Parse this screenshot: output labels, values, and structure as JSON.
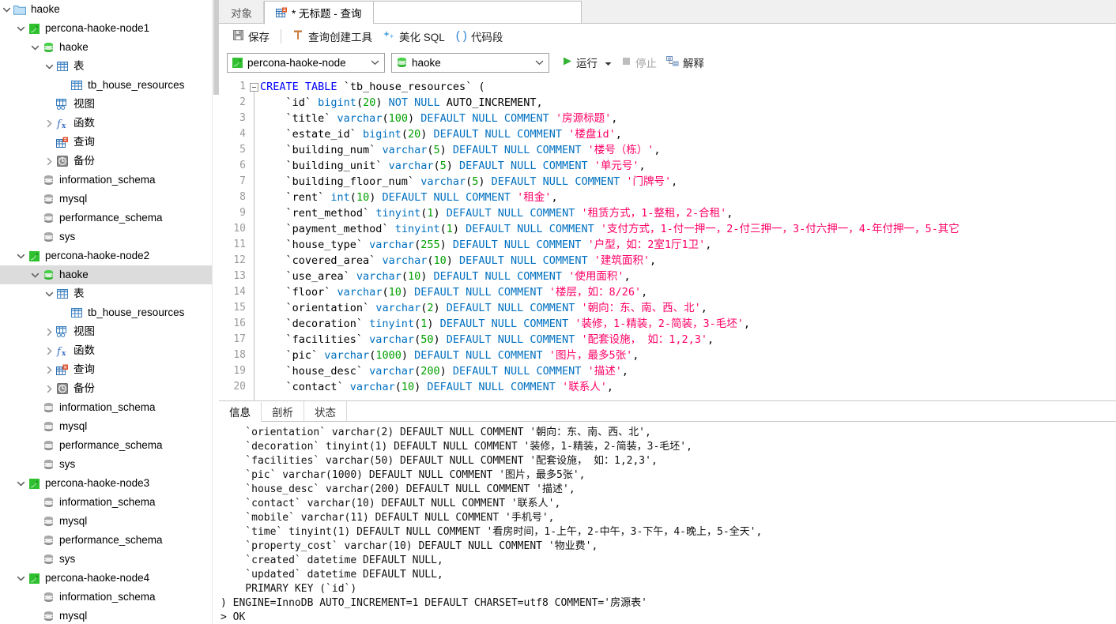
{
  "sidebar": {
    "items": [
      {
        "label": "haoke",
        "depth": 0,
        "icon": "folder-icon",
        "twisty": "down",
        "selected": false
      },
      {
        "label": "percona-haoke-node1",
        "depth": 1,
        "icon": "server-connection-icon",
        "twisty": "down",
        "selected": false
      },
      {
        "label": "haoke",
        "depth": 2,
        "icon": "database-icon",
        "twisty": "down",
        "selected": false
      },
      {
        "label": "表",
        "depth": 3,
        "icon": "table-group-icon",
        "twisty": "down",
        "selected": false
      },
      {
        "label": "tb_house_resources",
        "depth": 4,
        "icon": "table-icon",
        "twisty": "none",
        "selected": false
      },
      {
        "label": "视图",
        "depth": 3,
        "icon": "view-icon",
        "twisty": "none",
        "selected": false
      },
      {
        "label": "函数",
        "depth": 3,
        "icon": "function-icon",
        "twisty": "right",
        "selected": false
      },
      {
        "label": "查询",
        "depth": 3,
        "icon": "query-icon",
        "twisty": "none",
        "selected": false
      },
      {
        "label": "备份",
        "depth": 3,
        "icon": "backup-icon",
        "twisty": "right",
        "selected": false
      },
      {
        "label": "information_schema",
        "depth": 2,
        "icon": "database-gray-icon",
        "twisty": "none",
        "selected": false
      },
      {
        "label": "mysql",
        "depth": 2,
        "icon": "database-gray-icon",
        "twisty": "none",
        "selected": false
      },
      {
        "label": "performance_schema",
        "depth": 2,
        "icon": "database-gray-icon",
        "twisty": "none",
        "selected": false
      },
      {
        "label": "sys",
        "depth": 2,
        "icon": "database-gray-icon",
        "twisty": "none",
        "selected": false
      },
      {
        "label": "percona-haoke-node2",
        "depth": 1,
        "icon": "server-connection-icon",
        "twisty": "down",
        "selected": false
      },
      {
        "label": "haoke",
        "depth": 2,
        "icon": "database-icon",
        "twisty": "down",
        "selected": true
      },
      {
        "label": "表",
        "depth": 3,
        "icon": "table-group-icon",
        "twisty": "down",
        "selected": false
      },
      {
        "label": "tb_house_resources",
        "depth": 4,
        "icon": "table-icon",
        "twisty": "none",
        "selected": false
      },
      {
        "label": "视图",
        "depth": 3,
        "icon": "view-icon",
        "twisty": "right",
        "selected": false
      },
      {
        "label": "函数",
        "depth": 3,
        "icon": "function-icon",
        "twisty": "right",
        "selected": false
      },
      {
        "label": "查询",
        "depth": 3,
        "icon": "query-icon",
        "twisty": "right",
        "selected": false
      },
      {
        "label": "备份",
        "depth": 3,
        "icon": "backup-icon",
        "twisty": "right",
        "selected": false
      },
      {
        "label": "information_schema",
        "depth": 2,
        "icon": "database-gray-icon",
        "twisty": "none",
        "selected": false
      },
      {
        "label": "mysql",
        "depth": 2,
        "icon": "database-gray-icon",
        "twisty": "none",
        "selected": false
      },
      {
        "label": "performance_schema",
        "depth": 2,
        "icon": "database-gray-icon",
        "twisty": "none",
        "selected": false
      },
      {
        "label": "sys",
        "depth": 2,
        "icon": "database-gray-icon",
        "twisty": "none",
        "selected": false
      },
      {
        "label": "percona-haoke-node3",
        "depth": 1,
        "icon": "server-connection-icon",
        "twisty": "down",
        "selected": false
      },
      {
        "label": "information_schema",
        "depth": 2,
        "icon": "database-gray-icon",
        "twisty": "none",
        "selected": false
      },
      {
        "label": "mysql",
        "depth": 2,
        "icon": "database-gray-icon",
        "twisty": "none",
        "selected": false
      },
      {
        "label": "performance_schema",
        "depth": 2,
        "icon": "database-gray-icon",
        "twisty": "none",
        "selected": false
      },
      {
        "label": "sys",
        "depth": 2,
        "icon": "database-gray-icon",
        "twisty": "none",
        "selected": false
      },
      {
        "label": "percona-haoke-node4",
        "depth": 1,
        "icon": "server-connection-icon",
        "twisty": "down",
        "selected": false
      },
      {
        "label": "information_schema",
        "depth": 2,
        "icon": "database-gray-icon",
        "twisty": "none",
        "selected": false
      },
      {
        "label": "mysql",
        "depth": 2,
        "icon": "database-gray-icon",
        "twisty": "none",
        "selected": false
      }
    ]
  },
  "tabs": {
    "objects": "对象",
    "query": "* 无标题 - 查询"
  },
  "toolbar": {
    "save": "保存",
    "query_builder": "查询创建工具",
    "beautify_sql": "美化 SQL",
    "code_snippet": "代码段",
    "run": "运行",
    "stop": "停止",
    "explain": "解释",
    "connection_value": "percona-haoke-node",
    "database_value": "haoke"
  },
  "editor": {
    "lines": [
      {
        "n": 1,
        "segs": [
          [
            "kw",
            "CREATE"
          ],
          [
            "plain",
            " "
          ],
          [
            "kw",
            "TABLE"
          ],
          [
            "plain",
            " `tb_house_resources` ("
          ]
        ]
      },
      {
        "n": 2,
        "segs": [
          [
            "plain",
            "    `id` "
          ],
          [
            "kw2",
            "bigint"
          ],
          [
            "plain",
            "("
          ],
          [
            "num",
            "20"
          ],
          [
            "plain",
            ") "
          ],
          [
            "kw2",
            "NOT NULL"
          ],
          [
            "plain",
            " AUTO_INCREMENT,"
          ]
        ]
      },
      {
        "n": 3,
        "segs": [
          [
            "plain",
            "    `title` "
          ],
          [
            "kw2",
            "varchar"
          ],
          [
            "plain",
            "("
          ],
          [
            "num",
            "100"
          ],
          [
            "plain",
            ") "
          ],
          [
            "kw2",
            "DEFAULT NULL COMMENT"
          ],
          [
            "plain",
            " "
          ],
          [
            "str",
            "'房源标题'"
          ],
          [
            "plain",
            ","
          ]
        ]
      },
      {
        "n": 4,
        "segs": [
          [
            "plain",
            "    `estate_id` "
          ],
          [
            "kw2",
            "bigint"
          ],
          [
            "plain",
            "("
          ],
          [
            "num",
            "20"
          ],
          [
            "plain",
            ") "
          ],
          [
            "kw2",
            "DEFAULT NULL COMMENT"
          ],
          [
            "plain",
            " "
          ],
          [
            "str",
            "'楼盘id'"
          ],
          [
            "plain",
            ","
          ]
        ]
      },
      {
        "n": 5,
        "segs": [
          [
            "plain",
            "    `building_num` "
          ],
          [
            "kw2",
            "varchar"
          ],
          [
            "plain",
            "("
          ],
          [
            "num",
            "5"
          ],
          [
            "plain",
            ") "
          ],
          [
            "kw2",
            "DEFAULT NULL COMMENT"
          ],
          [
            "plain",
            " "
          ],
          [
            "str",
            "'楼号（栋）'"
          ],
          [
            "plain",
            ","
          ]
        ]
      },
      {
        "n": 6,
        "segs": [
          [
            "plain",
            "    `building_unit` "
          ],
          [
            "kw2",
            "varchar"
          ],
          [
            "plain",
            "("
          ],
          [
            "num",
            "5"
          ],
          [
            "plain",
            ") "
          ],
          [
            "kw2",
            "DEFAULT NULL COMMENT"
          ],
          [
            "plain",
            " "
          ],
          [
            "str",
            "'单元号'"
          ],
          [
            "plain",
            ","
          ]
        ]
      },
      {
        "n": 7,
        "segs": [
          [
            "plain",
            "    `building_floor_num` "
          ],
          [
            "kw2",
            "varchar"
          ],
          [
            "plain",
            "("
          ],
          [
            "num",
            "5"
          ],
          [
            "plain",
            ") "
          ],
          [
            "kw2",
            "DEFAULT NULL COMMENT"
          ],
          [
            "plain",
            " "
          ],
          [
            "str",
            "'门牌号'"
          ],
          [
            "plain",
            ","
          ]
        ]
      },
      {
        "n": 8,
        "segs": [
          [
            "plain",
            "    `rent` "
          ],
          [
            "kw2",
            "int"
          ],
          [
            "plain",
            "("
          ],
          [
            "num",
            "10"
          ],
          [
            "plain",
            ") "
          ],
          [
            "kw2",
            "DEFAULT NULL COMMENT"
          ],
          [
            "plain",
            " "
          ],
          [
            "str",
            "'租金'"
          ],
          [
            "plain",
            ","
          ]
        ]
      },
      {
        "n": 9,
        "segs": [
          [
            "plain",
            "    `rent_method` "
          ],
          [
            "kw2",
            "tinyint"
          ],
          [
            "plain",
            "("
          ],
          [
            "num",
            "1"
          ],
          [
            "plain",
            ") "
          ],
          [
            "kw2",
            "DEFAULT NULL COMMENT"
          ],
          [
            "plain",
            " "
          ],
          [
            "str",
            "'租赁方式，1-整租，2-合租'"
          ],
          [
            "plain",
            ","
          ]
        ]
      },
      {
        "n": 10,
        "segs": [
          [
            "plain",
            "    `payment_method` "
          ],
          [
            "kw2",
            "tinyint"
          ],
          [
            "plain",
            "("
          ],
          [
            "num",
            "1"
          ],
          [
            "plain",
            ") "
          ],
          [
            "kw2",
            "DEFAULT NULL COMMENT"
          ],
          [
            "plain",
            " "
          ],
          [
            "str",
            "'支付方式，1-付一押一，2-付三押一，3-付六押一，4-年付押一，5-其它"
          ]
        ]
      },
      {
        "n": 11,
        "segs": [
          [
            "plain",
            "    `house_type` "
          ],
          [
            "kw2",
            "varchar"
          ],
          [
            "plain",
            "("
          ],
          [
            "num",
            "255"
          ],
          [
            "plain",
            ") "
          ],
          [
            "kw2",
            "DEFAULT NULL COMMENT"
          ],
          [
            "plain",
            " "
          ],
          [
            "str",
            "'户型，如：2室1厅1卫'"
          ],
          [
            "plain",
            ","
          ]
        ]
      },
      {
        "n": 12,
        "segs": [
          [
            "plain",
            "    `covered_area` "
          ],
          [
            "kw2",
            "varchar"
          ],
          [
            "plain",
            "("
          ],
          [
            "num",
            "10"
          ],
          [
            "plain",
            ") "
          ],
          [
            "kw2",
            "DEFAULT NULL COMMENT"
          ],
          [
            "plain",
            " "
          ],
          [
            "str",
            "'建筑面积'"
          ],
          [
            "plain",
            ","
          ]
        ]
      },
      {
        "n": 13,
        "segs": [
          [
            "plain",
            "    `use_area` "
          ],
          [
            "kw2",
            "varchar"
          ],
          [
            "plain",
            "("
          ],
          [
            "num",
            "10"
          ],
          [
            "plain",
            ") "
          ],
          [
            "kw2",
            "DEFAULT NULL COMMENT"
          ],
          [
            "plain",
            " "
          ],
          [
            "str",
            "'使用面积'"
          ],
          [
            "plain",
            ","
          ]
        ]
      },
      {
        "n": 14,
        "segs": [
          [
            "plain",
            "    `floor` "
          ],
          [
            "kw2",
            "varchar"
          ],
          [
            "plain",
            "("
          ],
          [
            "num",
            "10"
          ],
          [
            "plain",
            ") "
          ],
          [
            "kw2",
            "DEFAULT NULL COMMENT"
          ],
          [
            "plain",
            " "
          ],
          [
            "str",
            "'楼层，如：8/26'"
          ],
          [
            "plain",
            ","
          ]
        ]
      },
      {
        "n": 15,
        "segs": [
          [
            "plain",
            "    `orientation` "
          ],
          [
            "kw2",
            "varchar"
          ],
          [
            "plain",
            "("
          ],
          [
            "num",
            "2"
          ],
          [
            "plain",
            ") "
          ],
          [
            "kw2",
            "DEFAULT NULL COMMENT"
          ],
          [
            "plain",
            " "
          ],
          [
            "str",
            "'朝向：东、南、西、北'"
          ],
          [
            "plain",
            ","
          ]
        ]
      },
      {
        "n": 16,
        "segs": [
          [
            "plain",
            "    `decoration` "
          ],
          [
            "kw2",
            "tinyint"
          ],
          [
            "plain",
            "("
          ],
          [
            "num",
            "1"
          ],
          [
            "plain",
            ") "
          ],
          [
            "kw2",
            "DEFAULT NULL COMMENT"
          ],
          [
            "plain",
            " "
          ],
          [
            "str",
            "'装修，1-精装，2-简装，3-毛坯'"
          ],
          [
            "plain",
            ","
          ]
        ]
      },
      {
        "n": 17,
        "segs": [
          [
            "plain",
            "    `facilities` "
          ],
          [
            "kw2",
            "varchar"
          ],
          [
            "plain",
            "("
          ],
          [
            "num",
            "50"
          ],
          [
            "plain",
            ") "
          ],
          [
            "kw2",
            "DEFAULT NULL COMMENT"
          ],
          [
            "plain",
            " "
          ],
          [
            "str",
            "'配套设施， 如：1,2,3'"
          ],
          [
            "plain",
            ","
          ]
        ]
      },
      {
        "n": 18,
        "segs": [
          [
            "plain",
            "    `pic` "
          ],
          [
            "kw2",
            "varchar"
          ],
          [
            "plain",
            "("
          ],
          [
            "num",
            "1000"
          ],
          [
            "plain",
            ") "
          ],
          [
            "kw2",
            "DEFAULT NULL COMMENT"
          ],
          [
            "plain",
            " "
          ],
          [
            "str",
            "'图片，最多5张'"
          ],
          [
            "plain",
            ","
          ]
        ]
      },
      {
        "n": 19,
        "segs": [
          [
            "plain",
            "    `house_desc` "
          ],
          [
            "kw2",
            "varchar"
          ],
          [
            "plain",
            "("
          ],
          [
            "num",
            "200"
          ],
          [
            "plain",
            ") "
          ],
          [
            "kw2",
            "DEFAULT NULL COMMENT"
          ],
          [
            "plain",
            " "
          ],
          [
            "str",
            "'描述'"
          ],
          [
            "plain",
            ","
          ]
        ]
      },
      {
        "n": 20,
        "segs": [
          [
            "plain",
            "    `contact` "
          ],
          [
            "kw2",
            "varchar"
          ],
          [
            "plain",
            "("
          ],
          [
            "num",
            "10"
          ],
          [
            "plain",
            ") "
          ],
          [
            "kw2",
            "DEFAULT NULL COMMENT"
          ],
          [
            "plain",
            " "
          ],
          [
            "str",
            "'联系人'"
          ],
          [
            "plain",
            ","
          ]
        ]
      }
    ]
  },
  "results": {
    "tabs": [
      "信息",
      "剖析",
      "状态"
    ],
    "active_tab": "信息",
    "text": "    `orientation` varchar(2) DEFAULT NULL COMMENT '朝向：东、南、西、北',\n    `decoration` tinyint(1) DEFAULT NULL COMMENT '装修，1-精装，2-简装，3-毛坯',\n    `facilities` varchar(50) DEFAULT NULL COMMENT '配套设施， 如：1,2,3',\n    `pic` varchar(1000) DEFAULT NULL COMMENT '图片，最多5张',\n    `house_desc` varchar(200) DEFAULT NULL COMMENT '描述',\n    `contact` varchar(10) DEFAULT NULL COMMENT '联系人',\n    `mobile` varchar(11) DEFAULT NULL COMMENT '手机号',\n    `time` tinyint(1) DEFAULT NULL COMMENT '看房时间，1-上午，2-中午，3-下午，4-晚上，5-全天',\n    `property_cost` varchar(10) DEFAULT NULL COMMENT '物业费',\n    `created` datetime DEFAULT NULL,\n    `updated` datetime DEFAULT NULL,\n    PRIMARY KEY (`id`)\n) ENGINE=InnoDB AUTO_INCREMENT=1 DEFAULT CHARSET=utf8 COMMENT='房源表'\n> OK"
  },
  "colors": {
    "keyword": "#0000ff",
    "type_keyword": "#0070c0",
    "number": "#00a000",
    "string": "#ff0066",
    "selection": "#dcdcdc",
    "green_db": "#22a22a"
  }
}
